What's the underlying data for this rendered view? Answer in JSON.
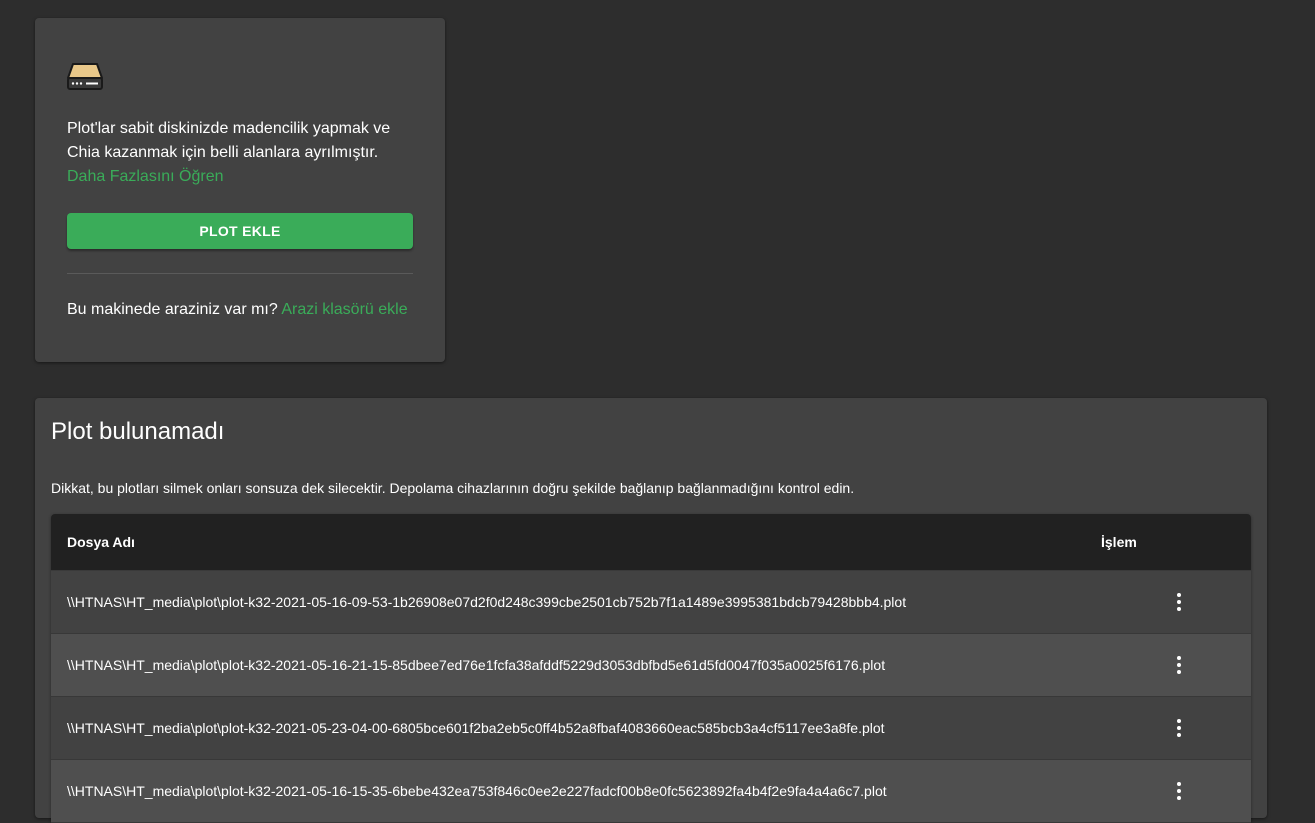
{
  "plots_card": {
    "icon": "hdd-icon",
    "description": "Plot'lar sabit diskinizde madencilik yapmak ve Chia kazanmak için belli alanlara ayrılmıştır.",
    "learn_more": "Daha Fazlasını Öğren",
    "add_plot_button": "PLOT EKLE",
    "farm_question": "Bu makinede araziniz var mı?",
    "add_farm_folder_link": "Arazi klasörü ekle"
  },
  "not_found": {
    "title": "Plot bulunamadı",
    "warning": "Dikkat, bu plotları silmek onları sonsuza dek silecektir. Depolama cihazlarının doğru şekilde bağlanıp bağlanmadığını kontrol edin.",
    "columns": {
      "filename": "Dosya Adı",
      "action": "İşlem"
    },
    "rows": [
      {
        "filename": "\\\\HTNAS\\HT_media\\plot\\plot-k32-2021-05-16-09-53-1b26908e07d2f0d248c399cbe2501cb752b7f1a1489e3995381bdcb79428bbb4.plot"
      },
      {
        "filename": "\\\\HTNAS\\HT_media\\plot\\plot-k32-2021-05-16-21-15-85dbee7ed76e1fcfa38afddf5229d3053dbfbd5e61d5fd0047f035a0025f6176.plot"
      },
      {
        "filename": "\\\\HTNAS\\HT_media\\plot\\plot-k32-2021-05-23-04-00-6805bce601f2ba2eb5c0ff4b52a8fbaf4083660eac585bcb3a4cf5117ee3a8fe.plot"
      },
      {
        "filename": "\\\\HTNAS\\HT_media\\plot\\plot-k32-2021-05-16-15-35-6bebe432ea753f846c0ee2e227fadcf00b8e0fc5623892fa4b4f2e9fa4a4a6c7.plot"
      }
    ]
  },
  "colors": {
    "accent": "#3aac59",
    "background": "#2d2d2d",
    "card": "#424242",
    "table_header": "#212121"
  }
}
